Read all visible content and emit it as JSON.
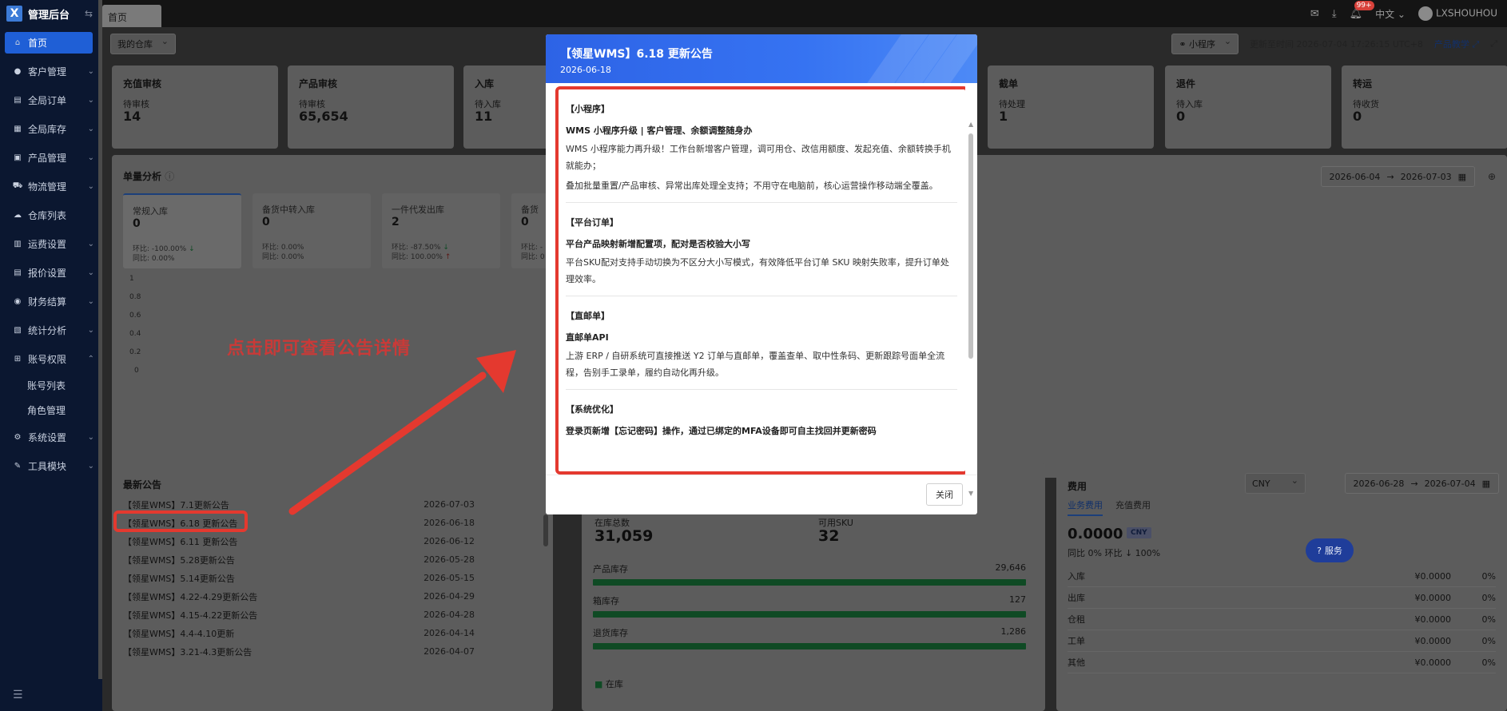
{
  "brand": {
    "title": "管理后台",
    "logo": "X"
  },
  "sidebar": {
    "items": [
      {
        "label": "首页",
        "icon": "home-icon",
        "active": true
      },
      {
        "label": "客户管理",
        "icon": "users-icon",
        "expandable": true
      },
      {
        "label": "全局订单",
        "icon": "orders-icon",
        "expandable": true
      },
      {
        "label": "全局库存",
        "icon": "inventory-icon",
        "expandable": true
      },
      {
        "label": "产品管理",
        "icon": "product-icon",
        "expandable": true
      },
      {
        "label": "物流管理",
        "icon": "truck-icon",
        "expandable": true
      },
      {
        "label": "仓库列表",
        "icon": "cloud-icon",
        "expandable": false
      },
      {
        "label": "运费设置",
        "icon": "freight-icon",
        "expandable": true
      },
      {
        "label": "报价设置",
        "icon": "quote-icon",
        "expandable": true
      },
      {
        "label": "财务结算",
        "icon": "finance-icon",
        "expandable": true
      },
      {
        "label": "统计分析",
        "icon": "stats-icon",
        "expandable": true
      },
      {
        "label": "账号权限",
        "icon": "org-icon",
        "expandable": true,
        "open": true
      },
      {
        "label": "系统设置",
        "icon": "settings-icon",
        "expandable": true
      },
      {
        "label": "工具模块",
        "icon": "tool-icon",
        "expandable": true
      }
    ],
    "subitems": [
      "账号列表",
      "角色管理"
    ]
  },
  "header": {
    "tab": "首页",
    "notification_count": "99+",
    "language": "中文",
    "user": "LXSHOUHOU"
  },
  "toolbar": {
    "warehouse": "我的仓库",
    "miniprogram": "小程序",
    "update_time": "更新至时间 2026-07-04 17:26:15 UTC+8",
    "teaching": "产品教学"
  },
  "stats": [
    {
      "title": "充值审核",
      "label": "待审核",
      "value": "14"
    },
    {
      "title": "产品审核",
      "label": "待审核",
      "value": "65,654"
    },
    {
      "title": "入库",
      "label": "待入库",
      "value": "11"
    },
    {
      "title": "截单",
      "label": "待处理",
      "value": "1"
    },
    {
      "title": "退件",
      "label": "待入库",
      "value": "0"
    },
    {
      "title": "转运",
      "label": "待收货",
      "value": "0"
    }
  ],
  "analysis": {
    "title": "单量分析",
    "date_start": "2026-06-04",
    "date_end": "2026-07-03",
    "cards": [
      {
        "label": "常规入库",
        "value": "0",
        "ring": "环比: -100.00%",
        "ring_trend": "↓",
        "yoy": "同比: 0.00%",
        "yoy_trend": ""
      },
      {
        "label": "备货中转入库",
        "value": "0",
        "ring": "环比: 0.00%",
        "ring_trend": "",
        "yoy": "同比: 0.00%",
        "yoy_trend": ""
      },
      {
        "label": "一件代发出库",
        "value": "2",
        "ring": "环比: -87.50%",
        "ring_trend": "↓",
        "yoy": "同比: 100.00%",
        "yoy_trend": "↑"
      },
      {
        "label": "备货",
        "value": "0",
        "ring": "环比: -",
        "ring_trend": "",
        "yoy": "同比: 0",
        "yoy_trend": ""
      }
    ],
    "y_ticks": [
      "1",
      "0.8",
      "0.6",
      "0.4",
      "0.2",
      "0"
    ]
  },
  "annotation": {
    "text": "点击即可查看公告详情"
  },
  "news": {
    "title": "最新公告",
    "items": [
      {
        "title": "【领星WMS】7.1更新公告",
        "date": "2026-07-03"
      },
      {
        "title": "【领星WMS】6.18 更新公告",
        "date": "2026-06-18"
      },
      {
        "title": "【领星WMS】6.11 更新公告",
        "date": "2026-06-12"
      },
      {
        "title": "【领星WMS】5.28更新公告",
        "date": "2026-05-28"
      },
      {
        "title": "【领星WMS】5.14更新公告",
        "date": "2026-05-15"
      },
      {
        "title": "【领星WMS】4.22-4.29更新公告",
        "date": "2026-04-29"
      },
      {
        "title": "【领星WMS】4.15-4.22更新公告",
        "date": "2026-04-28"
      },
      {
        "title": "【领星WMS】4.4-4.10更新",
        "date": "2026-04-14"
      },
      {
        "title": "【领星WMS】3.21-4.3更新公告",
        "date": "2026-04-07"
      }
    ]
  },
  "inventory": {
    "total_label": "在库总数",
    "total_value": "31,059",
    "sku_label": "可用SKU",
    "sku_value": "32",
    "bars": [
      {
        "label": "产品库存",
        "value": "29,646"
      },
      {
        "label": "箱库存",
        "value": "127"
      },
      {
        "label": "退货库存",
        "value": "1,286"
      }
    ],
    "legend": "在库"
  },
  "fees": {
    "title": "费用",
    "currency": "CNY",
    "date_start": "2026-06-28",
    "date_end": "2026-07-04",
    "tabs": [
      "业务费用",
      "充值费用"
    ],
    "total": "0.0000",
    "currency_tag": "CNY",
    "compare": "同比 0%   环比 ↓ 100%",
    "rows": [
      {
        "name": "入库",
        "amount": "¥0.0000",
        "pct": "0%"
      },
      {
        "name": "出库",
        "amount": "¥0.0000",
        "pct": "0%"
      },
      {
        "name": "仓租",
        "amount": "¥0.0000",
        "pct": "0%"
      },
      {
        "name": "工单",
        "amount": "¥0.0000",
        "pct": "0%"
      },
      {
        "name": "其他",
        "amount": "¥0.0000",
        "pct": "0%"
      }
    ],
    "service": "服务"
  },
  "modal": {
    "title": "【领星WMS】6.18 更新公告",
    "date": "2026-06-18",
    "sections": [
      {
        "tag": "【小程序】",
        "heading": "WMS 小程序升级 | 客户管理、余额调整随身办",
        "paragraphs": [
          "WMS 小程序能力再升级！工作台新增客户管理，调可用仓、改信用额度、发起充值、余额转换手机就能办；",
          "叠加批量重置/产品审核、异常出库处理全支持；不用守在电脑前，核心运营操作移动端全覆盖。"
        ]
      },
      {
        "tag": "【平台订单】",
        "heading": "平台产品映射新增配置项，配对是否校验大小写",
        "paragraphs": [
          "平台SKU配对支持手动切换为不区分大小写模式，有效降低平台订单 SKU 映射失败率，提升订单处理效率。"
        ]
      },
      {
        "tag": "【直邮单】",
        "heading": "直邮单API",
        "paragraphs": [
          "上游 ERP / 自研系统可直接推送 Y2 订单与直邮单，覆盖查单、取中性条码、更新跟踪号面单全流程，告别手工录单，履约自动化再升级。"
        ]
      },
      {
        "tag": "【系统优化】",
        "heading": "登录页新增【忘记密码】操作，通过已绑定的MFA设备即可自主找回并更新密码",
        "paragraphs": []
      }
    ],
    "close_label": "关闭"
  }
}
